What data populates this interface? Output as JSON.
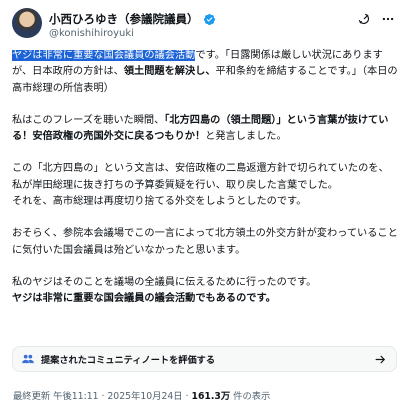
{
  "author": {
    "display_name": "小西ひろゆき（参議院議員）",
    "handle": "@konishihiroyuki"
  },
  "tweet": {
    "p1": {
      "highlight": "ヤジは非常に重要な国会議員の議会活動",
      "rest_a": "です。「日露関係は厳しい状況にありますが、日本政府の方針は、",
      "bold": "領土問題を解決し、",
      "rest_b": "平和条約を締結することです。」（本日の高市総理の所信表明）"
    },
    "p2": {
      "a": "私はこのフレーズを聴いた瞬間、",
      "bold": "「北方四島の（領土問題）」という言葉が抜けている！安倍政権の売国外交に戻るつもりか！",
      "b": "と発言しました。"
    },
    "p3": {
      "line1": "この「北方四島の」という文言は、安倍政権の二島返還方針で切られていたのを、私が岸田総理に抜き打ちの予算委質疑を行い、取り戻した言葉でした。",
      "line2": "それを、高市総理は再度切り捨てる外交をしようとしたのです。"
    },
    "p4": "おそらく、参院本会議場でこの一言によって北方領土の外交方針が変わっていることに気付いた国会議員は殆どいなかったと思います。",
    "p5": {
      "line1": "私のヤジはそのことを議場の全議員に伝えるために行ったのです。",
      "line2_bold": "ヤジは非常に重要な国会議員の議会活動でもあるのです。"
    }
  },
  "community_note": {
    "label": "提案されたコミュニティノートを評価する"
  },
  "meta": {
    "prefix": "最終更新 午後11:11 · 2025年10月24日 · ",
    "views": "161.3万",
    "suffix": " 件の表示"
  },
  "colors": {
    "highlight": "#1d63d8",
    "verified": "#1d9bf0",
    "muted": "#536471"
  },
  "icons": [
    "verified-badge-icon",
    "grok-icon",
    "more-icon",
    "community-notes-icon",
    "arrow-right-icon"
  ]
}
